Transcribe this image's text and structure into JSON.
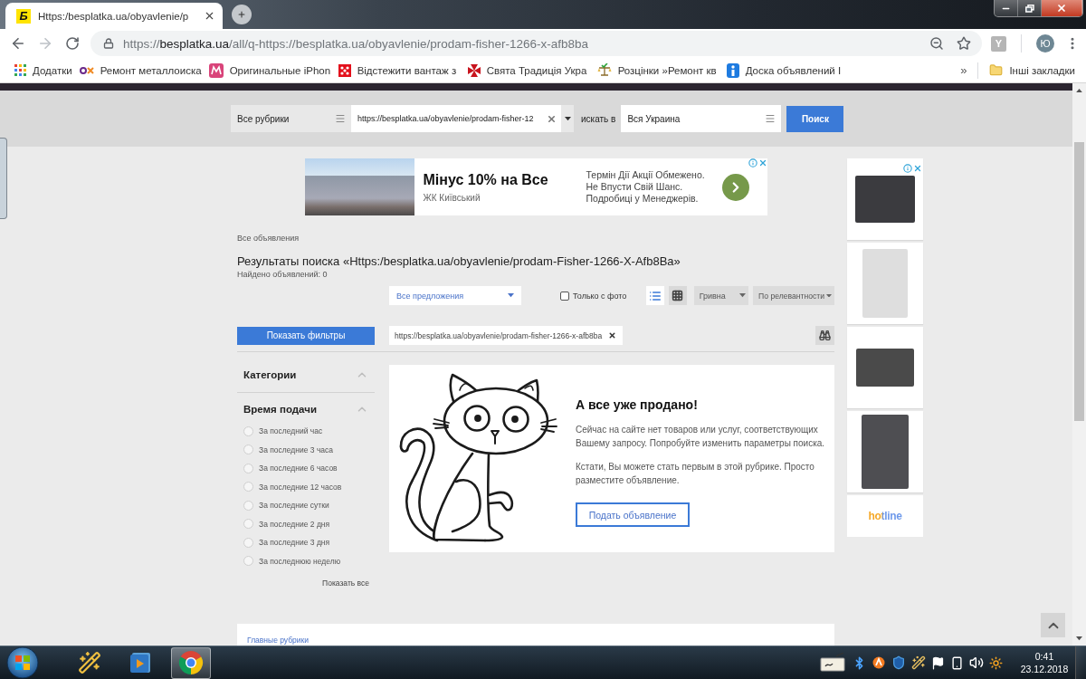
{
  "browser": {
    "tabs": [
      {
        "favicon": "Б",
        "title": "Https:/besplatka.ua/obyavlenie/p",
        "selected": true
      }
    ],
    "address": "https://**besplatka.ua**/all/q-https://besplatka.ua/obyavlenie/prodam-fisher-1266-x-afb8ba",
    "extension_badge": "Y",
    "profile_initial": "Ю",
    "bookmarks": [
      {
        "label": "Додатки"
      },
      {
        "label": "Ремонт металлоиска"
      },
      {
        "label": "Оригинальные iPhon"
      },
      {
        "label": "Відстежити вантаж з"
      },
      {
        "label": "Свята Традиція Укра"
      },
      {
        "label": "Розцінки »Ремонт кв"
      },
      {
        "label": "Доска объявлений I"
      }
    ],
    "bookmarks_overflow": "»",
    "other_bookmarks": "Інші закладки"
  },
  "search_bar": {
    "category": "Все рубрики",
    "query": "https://besplatka.ua/obyavlenie/prodam-fisher-12",
    "search_in_label": "искать в",
    "region": "Вся Украина",
    "button": "Поиск"
  },
  "ad_banner": {
    "title": "Мінус 10% на Все",
    "subtitle": "ЖК Київський",
    "lines": [
      "Термін Дії Акції Обмежено.",
      "Не Впусти Свій Шанс.",
      "Подробиці у Менеджерів."
    ]
  },
  "breadcrumb": "Все объявления",
  "heading": "Результаты поиска «Https:/besplatka.ua/obyavlenie/prodam-Fisher-1266-X-Afb8Ba»",
  "found_count": "Найдено объявлений: 0",
  "toolbar": {
    "offer_filter": "Все предложения",
    "photo_only": {
      "label": "Только с фото",
      "checked": false
    },
    "views": [
      {
        "kind": "list",
        "selected": true
      },
      {
        "kind": "grid",
        "selected": false
      }
    ],
    "currency": "Гривна",
    "sort": "По релевантности"
  },
  "show_filters_button": "Показать фильтры",
  "active_tags": [
    {
      "label": "https://besplatka.ua/obyavlenie/prodam-fisher-1266-x-afb8ba"
    }
  ],
  "sidebar": {
    "sections": [
      {
        "title": "Категории",
        "expanded": true
      },
      {
        "title": "Время подачи",
        "expanded": true,
        "options": [
          {
            "label": "За последний час",
            "selected": false
          },
          {
            "label": "За последние 3 часа",
            "selected": false
          },
          {
            "label": "За последние 6 часов",
            "selected": false
          },
          {
            "label": "За последние 12 часов",
            "selected": false
          },
          {
            "label": "За последние сутки",
            "selected": false
          },
          {
            "label": "За последние 2 дня",
            "selected": false
          },
          {
            "label": "За последние 3 дня",
            "selected": false
          },
          {
            "label": "За последнюю неделю",
            "selected": false
          }
        ]
      }
    ],
    "show_all": "Показать все"
  },
  "empty_state": {
    "title": "А все уже продано!",
    "paragraphs": [
      "Сейчас на сайте нет товаров или услуг, соответствующих Вашему запросу. Попробуйте изменить параметры поиска.",
      "Кстати, Вы можете стать первым в этой рубрике. Просто разместите объявление."
    ],
    "button": "Подать объявление"
  },
  "side_ads": {
    "logo": "hotline"
  },
  "footer": {
    "link": "Главные рубрики"
  },
  "taskbar": {
    "apps": [
      {
        "selected": false
      },
      {
        "selected": false
      },
      {
        "selected": true
      }
    ],
    "clock": {
      "time": "0:41",
      "date": "23.12.2018"
    }
  }
}
